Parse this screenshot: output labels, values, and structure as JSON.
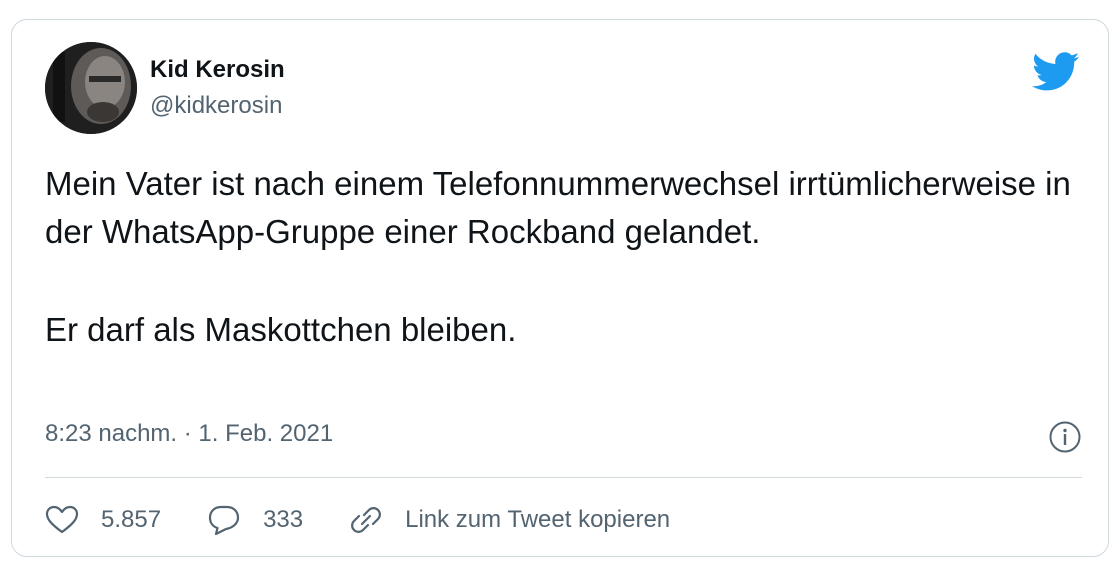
{
  "tweet": {
    "author_name": "Kid Kerosin",
    "author_handle": "@kidkerosin",
    "text_paragraph_1": "Mein Vater ist nach einem Telefonnummerwechsel irrtümlicherweise in der WhatsApp-Gruppe einer Rockband gelandet.",
    "text_paragraph_2": "Er darf als Maskottchen bleiben.",
    "timestamp": "8:23 nachm. · 1. Feb. 2021",
    "likes": "5.857",
    "replies": "333",
    "copy_link_label": "Link zum Tweet kopieren"
  },
  "icons": {
    "brand": "twitter-bird-icon",
    "info": "info-icon",
    "like": "heart-icon",
    "reply": "speech-bubble-icon",
    "link": "link-icon"
  },
  "colors": {
    "brand_blue": "#1d9bf0",
    "text_primary": "#0f1419",
    "text_secondary": "#536471",
    "border": "#cfd9de"
  }
}
